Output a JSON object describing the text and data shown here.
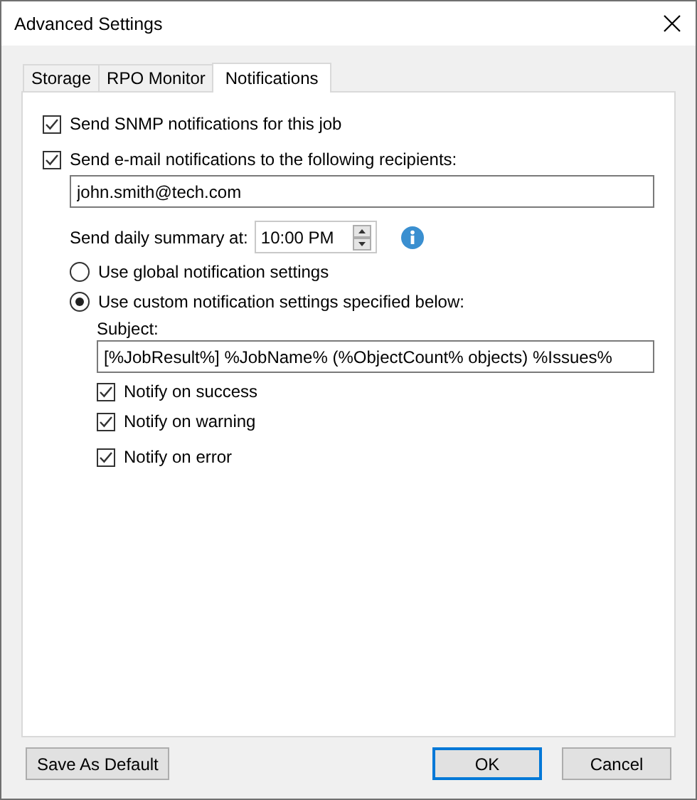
{
  "window": {
    "title": "Advanced Settings"
  },
  "tabs": [
    {
      "label": "Storage",
      "selected": false
    },
    {
      "label": "RPO Monitor",
      "selected": false
    },
    {
      "label": "Notifications",
      "selected": true
    }
  ],
  "snmp": {
    "label": "Send SNMP notifications for this job",
    "checked": true
  },
  "email": {
    "label": "Send e-mail notifications to the following recipients:",
    "checked": true,
    "recipients": "john.smith@tech.com"
  },
  "daily_summary": {
    "label": "Send daily summary at:",
    "time": "10:00 PM"
  },
  "mode": [
    {
      "label": "Use global notification settings",
      "selected": false
    },
    {
      "label": "Use custom notification settings specified below:",
      "selected": true
    }
  ],
  "subject": {
    "label": "Subject:",
    "value": "[%JobResult%] %JobName% (%ObjectCount% objects) %Issues%"
  },
  "notify": [
    {
      "label": "Notify on success",
      "checked": true
    },
    {
      "label": "Notify on warning",
      "checked": true
    },
    {
      "label": "Notify on error",
      "checked": true
    }
  ],
  "buttons": [
    {
      "label": "Save As Default",
      "kind": "left",
      "focused": false
    },
    {
      "label": "OK",
      "kind": "right",
      "focused": true
    },
    {
      "label": "Cancel",
      "kind": "right",
      "focused": false
    }
  ]
}
